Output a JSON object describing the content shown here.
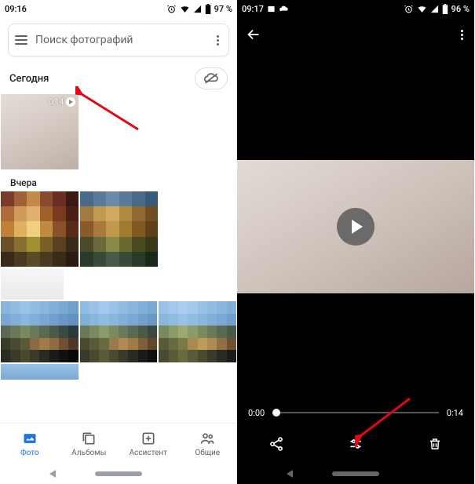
{
  "left": {
    "status": {
      "time": "09:16",
      "battery": "97 %",
      "icons": [
        "alarm",
        "wifi",
        "signal",
        "battery"
      ]
    },
    "search": {
      "placeholder": "Поиск фотографий"
    },
    "section_today": {
      "title": "Сегодня"
    },
    "video_thumb": {
      "duration": "0:14"
    },
    "section_yesterday": {
      "title": "Вчера"
    },
    "nav": {
      "photos": "Фото",
      "albums": "Альбомы",
      "assistant": "Ассистент",
      "sharing": "Общие"
    }
  },
  "right": {
    "status": {
      "time": "09:17",
      "battery": "96 %",
      "icons": [
        "image",
        "cloud",
        "alarm",
        "wifi",
        "signal",
        "battery"
      ]
    },
    "scrubber": {
      "start": "0:00",
      "end": "0:14"
    },
    "actions": {
      "share": "share-icon",
      "edit": "tune-icon",
      "delete": "trash-icon"
    }
  }
}
